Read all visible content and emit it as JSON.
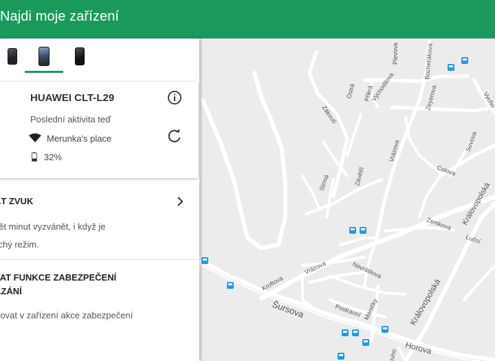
{
  "header": {
    "title": "Najdi moje zařízení"
  },
  "device_tabs": [
    {
      "icon": "phone-icon",
      "active": false
    },
    {
      "icon": "phone-icon",
      "active": true
    },
    {
      "icon": "phone-icon",
      "active": false
    }
  ],
  "device_card": {
    "name": "HUAWEI CLT-L29",
    "last_activity": "Poslední aktivita teď",
    "network": "Merunka's place",
    "battery": "32%",
    "battery_level": 0.32
  },
  "actions": [
    {
      "title": "ÁT ZVUK",
      "desc_lines": [
        "pět minut vyzvánět, i když je",
        "tichý režim."
      ]
    },
    {
      "title_lines": [
        "VAT FUNKCE ZABEZPEČENÍ",
        "AZÁNÍ"
      ],
      "desc_lines": [
        "ivovat v zařízení akce zabezpečení"
      ]
    }
  ],
  "map": {
    "street_labels": [
      "Plevova",
      "Bocheťákova",
      "Východilova",
      "Přikrá",
      "Ostrá",
      "Zákoutí",
      "Zeyerova",
      "Vycho",
      "Sovova",
      "Colova",
      "Vrázova",
      "Závětří",
      "Strmá",
      "Královopolská",
      "Zemkova",
      "Luční",
      "Kroftova",
      "Vrázova",
      "Navrátilova",
      "Postranní",
      "Maničky",
      "Šursova",
      "Královopolská",
      "Horova",
      "Ivho"
    ],
    "colors": {
      "road": "#ffffff",
      "land": "#ececec",
      "transit": "#1e9be8"
    }
  },
  "colors": {
    "accent": "#1a9a5a"
  }
}
